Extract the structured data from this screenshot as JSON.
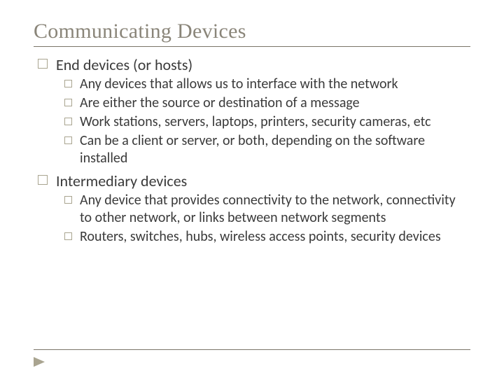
{
  "title": "Communicating Devices",
  "sections": [
    {
      "heading": "End devices (or hosts)",
      "items": [
        "Any devices that allows us to interface with the network",
        "Are either the source or destination of a message",
        "Work stations, servers, laptops, printers, security cameras,  etc",
        "Can be a client or server, or both, depending on the software installed"
      ]
    },
    {
      "heading": "Intermediary devices",
      "items": [
        "Any device that provides connectivity to the network, connectivity to other network, or links between network segments",
        "Routers, switches, hubs, wireless access points, security devices"
      ]
    }
  ]
}
